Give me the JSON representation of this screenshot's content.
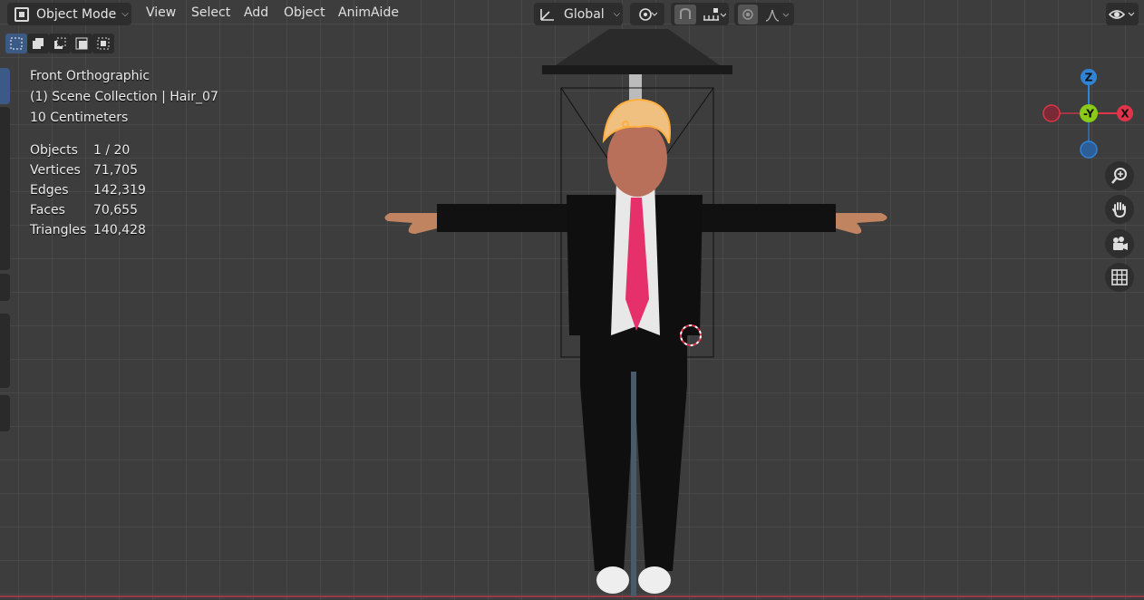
{
  "header": {
    "mode": "Object Mode",
    "menus": [
      "View",
      "Select",
      "Add",
      "Object",
      "AnimAide"
    ],
    "transform_orientation": "Global"
  },
  "overlay": {
    "view_name": "Front Orthographic",
    "collection": "(1) Scene Collection | Hair_07",
    "scale": "10 Centimeters"
  },
  "stats": [
    {
      "label": "Objects",
      "value": "1 / 20"
    },
    {
      "label": "Vertices",
      "value": "71,705"
    },
    {
      "label": "Edges",
      "value": "142,319"
    },
    {
      "label": "Faces",
      "value": "70,655"
    },
    {
      "label": "Triangles",
      "value": "140,428"
    }
  ],
  "gizmo": {
    "z": "Z",
    "y": "-Y",
    "x": "X"
  },
  "colors": {
    "accent": "#3b5a86",
    "x_axis": "#e0344a",
    "y_axis": "#8acb1a",
    "z_axis": "#2f84d6",
    "tie": "#e5306b"
  }
}
